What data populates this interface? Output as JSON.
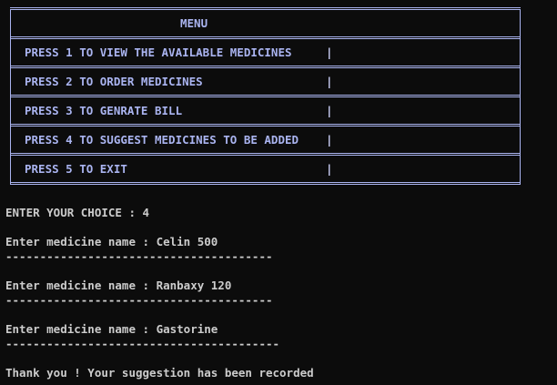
{
  "menu": {
    "title": "MENU",
    "options": [
      "PRESS 1 TO VIEW THE AVAILABLE MEDICINES",
      "PRESS 2 TO ORDER MEDICINES",
      "PRESS 3 TO GENRATE BILL",
      "PRESS 4 TO SUGGEST MEDICINES TO BE ADDED",
      "PRESS 5 TO EXIT"
    ],
    "option_pipe": "|"
  },
  "console": {
    "choice_prompt": "ENTER YOUR CHOICE : ",
    "choice_value": "4",
    "entries": [
      {
        "prompt": "Enter medicine name : ",
        "value": "Celin 500",
        "separator": "---------------------------------------"
      },
      {
        "prompt": "Enter medicine name : ",
        "value": "Ranbaxy 120",
        "separator": "---------------------------------------"
      },
      {
        "prompt": "Enter medicine name : ",
        "value": "Gastorine",
        "separator": "----------------------------------------"
      }
    ],
    "final_message": "Thank you ! Your suggestion has been recorded"
  },
  "colors": {
    "background": "#0c0c0c",
    "menu_border": "#aab4f0",
    "menu_text": "#aab4f0",
    "console_text": "#cccccc"
  }
}
